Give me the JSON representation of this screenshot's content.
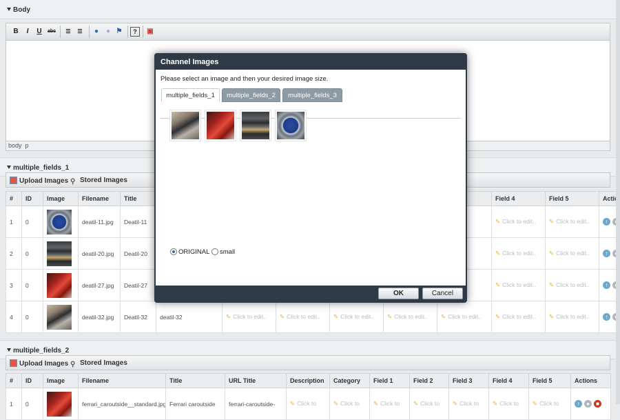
{
  "body_section": {
    "title": "Body",
    "status_path": [
      "body",
      "p"
    ]
  },
  "toolbar": {
    "bold": "B",
    "italic": "I",
    "underline": "U",
    "strike": "abc"
  },
  "section1": {
    "title": "multiple_fields_1",
    "upload_label": "Upload Images",
    "stored_label": "Stored Images",
    "columns": [
      "#",
      "ID",
      "Image",
      "Filename",
      "Title",
      "Field 4",
      "Field 5",
      "Actions"
    ],
    "rows": [
      {
        "num": "1",
        "id": "0",
        "filename": "deatil-11.jpg",
        "title": "Deatil-11",
        "img": "clock"
      },
      {
        "num": "2",
        "id": "0",
        "filename": "deatil-20.jpg",
        "title": "Deatil-20",
        "img": "dash"
      },
      {
        "num": "3",
        "id": "0",
        "filename": "deatil-27.jpg",
        "title": "Deatil-27",
        "img": "red"
      },
      {
        "num": "4",
        "id": "0",
        "filename": "deatil-32.jpg",
        "title": "Deatil-32",
        "img": "car",
        "url_title": "deatil-32"
      }
    ],
    "click_to_edit": "Click to edit.."
  },
  "section2": {
    "title": "multiple_fields_2",
    "upload_label": "Upload Images",
    "stored_label": "Stored Images",
    "columns": [
      "#",
      "ID",
      "Image",
      "Filename",
      "Title",
      "URL Title",
      "Description",
      "Category",
      "Field 1",
      "Field 2",
      "Field 3",
      "Field 4",
      "Field 5",
      "Actions"
    ],
    "row": {
      "num": "1",
      "id": "0",
      "filename": "ferrari_caroutside__standard.jpg",
      "title": "Ferrari caroutside",
      "url_title": "ferrari-caroutside-"
    },
    "click_to": "Click to"
  },
  "modal": {
    "title": "Channel Images",
    "instruction": "Please select an image and then your desired image size.",
    "tabs": [
      "multiple_fields_1",
      "multiple_fields_2",
      "multiple_fields_3"
    ],
    "active_tab": 0,
    "sizes": [
      "ORIGINAL",
      "small"
    ],
    "selected_size": "ORIGINAL",
    "ok_label": "OK",
    "cancel_label": "Cancel"
  },
  "colors": {
    "modal_frame": "#2e3a45",
    "tab_inactive": "#8d9ba4",
    "delete": "#c23a1e",
    "info": "#6fa8c9"
  }
}
